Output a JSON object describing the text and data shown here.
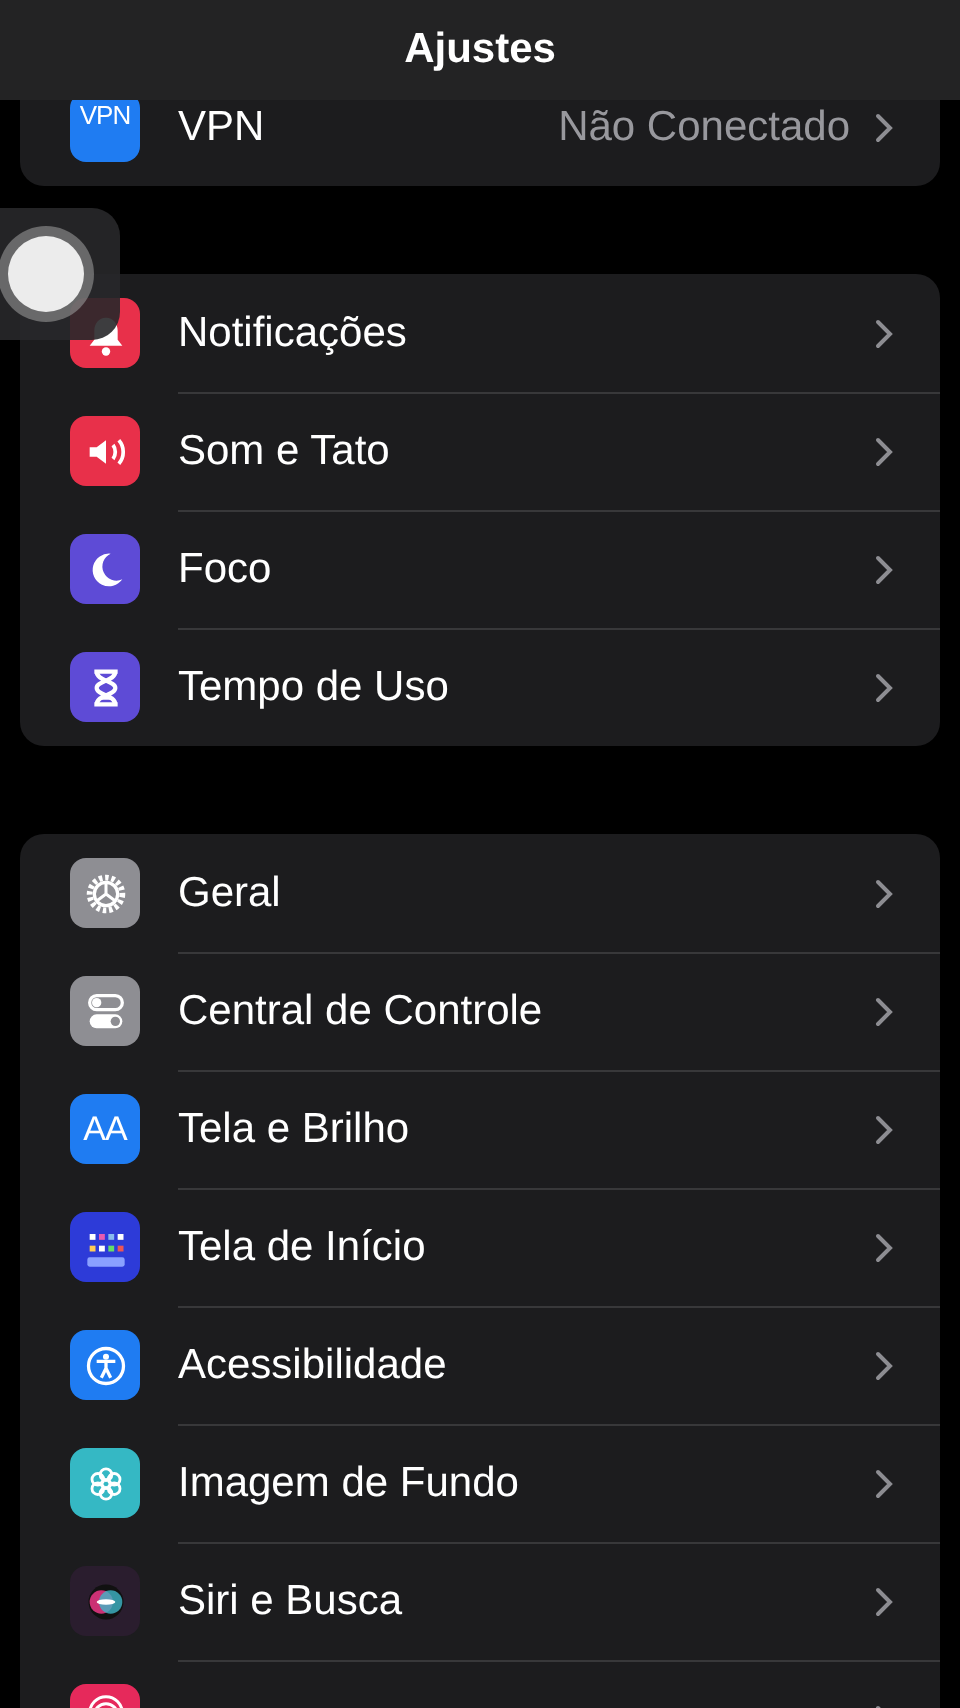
{
  "header": {
    "title": "Ajustes"
  },
  "groups": [
    {
      "rows": [
        {
          "kind": "vpn",
          "icon_text": "VPN",
          "color": "#1f7cf2",
          "label": "VPN",
          "value": "Não Conectado"
        }
      ]
    },
    {
      "rows": [
        {
          "kind": "bell",
          "color": "#e8304a",
          "label": "Notificações"
        },
        {
          "kind": "speaker",
          "color": "#e8304a",
          "label": "Som e Tato"
        },
        {
          "kind": "moon",
          "color": "#5e4bd6",
          "label": "Foco"
        },
        {
          "kind": "hourglass",
          "color": "#5e4bd6",
          "label": "Tempo de Uso"
        }
      ]
    },
    {
      "rows": [
        {
          "kind": "gear",
          "color": "#8e8e93",
          "label": "Geral"
        },
        {
          "kind": "toggles",
          "color": "#8e8e93",
          "label": "Central de Controle"
        },
        {
          "kind": "text",
          "icon_text": "AA",
          "color": "#1f7cf2",
          "label": "Tela e Brilho"
        },
        {
          "kind": "grid",
          "color": "#2d3bd8",
          "label": "Tela de Início"
        },
        {
          "kind": "accessibility",
          "color": "#1f7cf2",
          "label": "Acessibilidade"
        },
        {
          "kind": "flower",
          "color": "#35b8c4",
          "label": "Imagem de Fundo"
        },
        {
          "kind": "siri",
          "color": "#2a1d2e",
          "label": "Siri e Busca"
        },
        {
          "kind": "fingerprint",
          "color": "#e6295b"
        }
      ]
    }
  ],
  "assistive_touch": {
    "visible": true
  }
}
